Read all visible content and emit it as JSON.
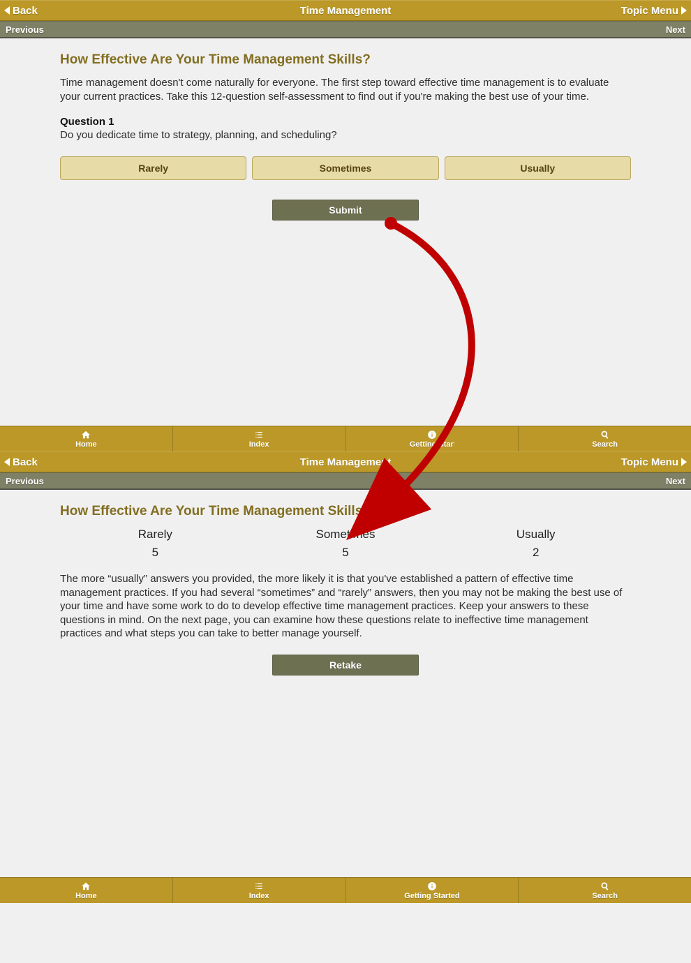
{
  "topbar": {
    "back": "Back",
    "title": "Time Management",
    "topic_menu": "Topic Menu"
  },
  "navbar": {
    "prev": "Previous",
    "next": "Next"
  },
  "page1": {
    "heading": "How Effective Are Your Time Management Skills?",
    "intro": "Time management doesn't come naturally for everyone. The first step toward effective time management is to evaluate your current practices. Take this 12-question self-assessment to find out if you're making the best use of your time.",
    "question_label": "Question 1",
    "question_text": "Do you dedicate time to strategy, planning, and scheduling?",
    "options": [
      "Rarely",
      "Sometimes",
      "Usually"
    ],
    "submit": "Submit"
  },
  "page2": {
    "heading": "How Effective Are Your Time Management Skills?",
    "results": [
      {
        "label": "Rarely",
        "value": "5"
      },
      {
        "label": "Sometimes",
        "value": "5"
      },
      {
        "label": "Usually",
        "value": "2"
      }
    ],
    "feedback": "The more “usually” answers you provided, the more likely it is that you've established a pattern of effective time management practices. If you had several “sometimes” and “rarely” answers, then you may not be making the best use of your time and have some work to do to develop effective time management practices. Keep your answers to these questions in mind. On the next page, you can examine how these questions relate to ineffective time management practices and what steps you can take to better manage yourself.",
    "retake": "Retake"
  },
  "botnav": {
    "home": "Home",
    "index": "Index",
    "getting_started": "Getting Started",
    "search": "Search"
  }
}
